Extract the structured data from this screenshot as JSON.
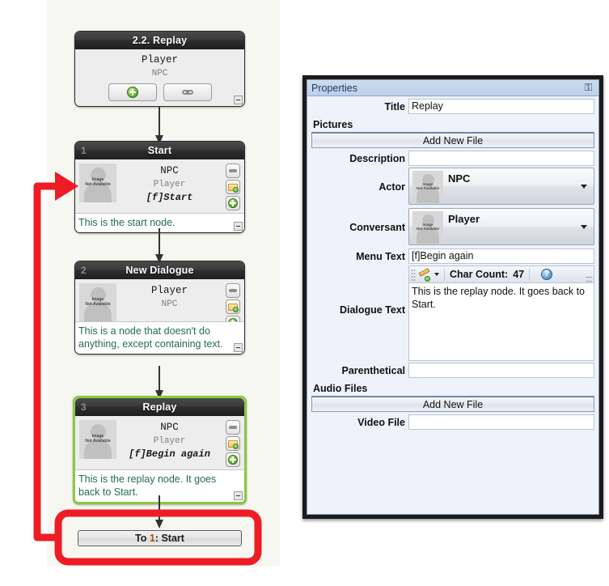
{
  "canvas": {
    "nodes": [
      {
        "id": "",
        "title": "2.2. Replay",
        "actor": "Player",
        "conversant": "NPC",
        "buttons": [
          "add-button",
          "link-button"
        ]
      },
      {
        "id": "1",
        "title": "Start",
        "actor": "NPC",
        "conversant": "Player",
        "menu_text": "[f]Start",
        "dialogue_text": "This is the start node.",
        "selected": false
      },
      {
        "id": "2",
        "title": "New Dialogue",
        "actor": "Player",
        "conversant": "NPC",
        "menu_text": "",
        "dialogue_text": "This is a node that doesn't do anything, except containing text.",
        "selected": false
      },
      {
        "id": "3",
        "title": "Replay",
        "actor": "NPC",
        "conversant": "Player",
        "menu_text": "[f]Begin again",
        "dialogue_text": "This is the replay node. It goes back to Start.",
        "selected": true
      }
    ],
    "link_button": {
      "prefix": "To ",
      "number": "1",
      "suffix": ": Start"
    },
    "annotation_color": "#ee1c24"
  },
  "properties": {
    "panel_title": "Properties",
    "pin_icon": "pin-icon",
    "fields": {
      "title_label": "Title",
      "title_value": "Replay",
      "pictures_label": "Pictures",
      "pictures_add_label": "Add New File",
      "description_label": "Description",
      "description_value": "",
      "actor_label": "Actor",
      "actor_value": "NPC",
      "conversant_label": "Conversant",
      "conversant_value": "Player",
      "menu_text_label": "Menu Text",
      "menu_text_value": "[f]Begin again",
      "char_count_label": "Char Count:",
      "char_count_value": "47",
      "dialogue_text_label": "Dialogue Text",
      "dialogue_text_value": "This is the replay node. It goes back to Start.",
      "parenthetical_label": "Parenthetical",
      "parenthetical_value": "",
      "audio_files_label": "Audio Files",
      "audio_add_label": "Add New File",
      "video_file_label": "Video File",
      "video_file_value": ""
    },
    "portrait_placeholder_line1": "Image",
    "portrait_placeholder_line2": "Not Available"
  }
}
